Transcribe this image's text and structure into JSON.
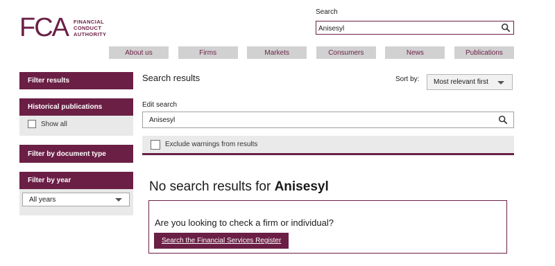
{
  "brand": {
    "mark": "FCA",
    "lines": [
      "FINANCIAL",
      "CONDUCT",
      "AUTHORITY"
    ]
  },
  "header": {
    "search_label": "Search",
    "search_value": "Anisesyl"
  },
  "nav": [
    "About us",
    "Firms",
    "Markets",
    "Consumers",
    "News",
    "Publications"
  ],
  "sidebar": {
    "filter_results": "Filter results",
    "historical": "Historical publications",
    "show_all": "Show all",
    "doc_type": "Filter by document type",
    "by_year": "Filter by year",
    "year_selected": "All years"
  },
  "main": {
    "title": "Search results",
    "sort_label": "Sort by:",
    "sort_selected": "Most relevant first",
    "edit_label": "Edit search",
    "edit_value": "Anisesyl",
    "exclude_label": "Exclude warnings from results",
    "no_results_prefix": "No search results for ",
    "no_results_term": "Anisesyl",
    "check_question": "Are you looking to check a firm or individual?",
    "register_button": "Search the Financial Services Register"
  },
  "colors": {
    "brand": "#6b1f45",
    "nav_bg": "#d1d1d1",
    "panel_bg": "#e9e9e9"
  },
  "icons": [
    "search-icon",
    "chevron-down-icon",
    "checkbox-icon"
  ]
}
